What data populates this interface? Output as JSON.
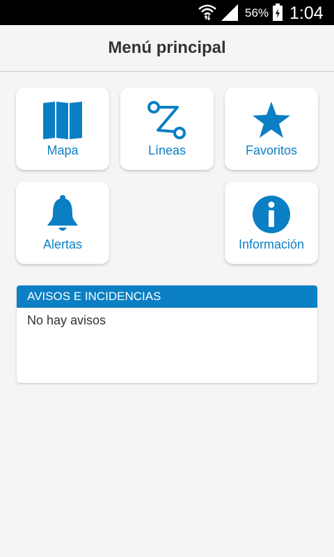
{
  "status_bar": {
    "battery_percent": "56%",
    "time": "1:04",
    "icons": [
      "wifi-icon",
      "signal-icon",
      "battery-charging-icon"
    ]
  },
  "header": {
    "title": "Menú principal"
  },
  "tiles": [
    {
      "label": "Mapa",
      "icon": "map-icon"
    },
    {
      "label": "Líneas",
      "icon": "route-icon"
    },
    {
      "label": "Favoritos",
      "icon": "star-icon"
    },
    {
      "label": "Alertas",
      "icon": "bell-icon"
    },
    {
      "label": "Información",
      "icon": "info-icon"
    }
  ],
  "notices": {
    "title": "AVISOS E INCIDENCIAS",
    "message": "No hay avisos"
  },
  "colors": {
    "accent": "#0a7fc4",
    "background": "#f5f5f5",
    "status_bar": "#000000"
  }
}
